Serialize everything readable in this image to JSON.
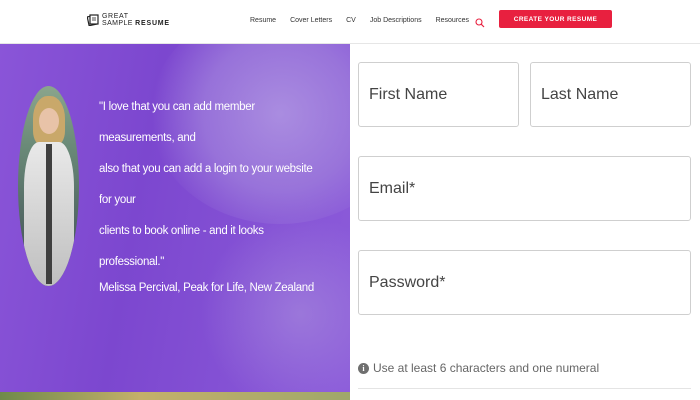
{
  "header": {
    "logo": {
      "line1": "GREAT",
      "line2_a": "SAMPLE ",
      "line2_b": "RESUME",
      "icon": "logo-icon"
    },
    "nav": [
      "Resume",
      "Cover Letters",
      "CV",
      "Job Descriptions",
      "Resources"
    ],
    "search_icon": "search-icon",
    "cta_label": "CREATE YOUR RESUME",
    "cta_color": "#e8203f"
  },
  "testimonial": {
    "quote_lines": [
      "\"I love that you can add member measurements, and",
      "also that you can add a login to your website for your",
      "clients to book online - and it looks professional.\""
    ],
    "author": "Melissa Percival, Peak for Life, New Zealand",
    "background_color": "#7c47cf"
  },
  "form": {
    "first_name_placeholder": "First Name",
    "last_name_placeholder": "Last Name",
    "email_placeholder": "Email*",
    "password_placeholder": "Password*",
    "hint": "Use at least 6 characters and one numeral",
    "hint_icon": "info-icon"
  }
}
